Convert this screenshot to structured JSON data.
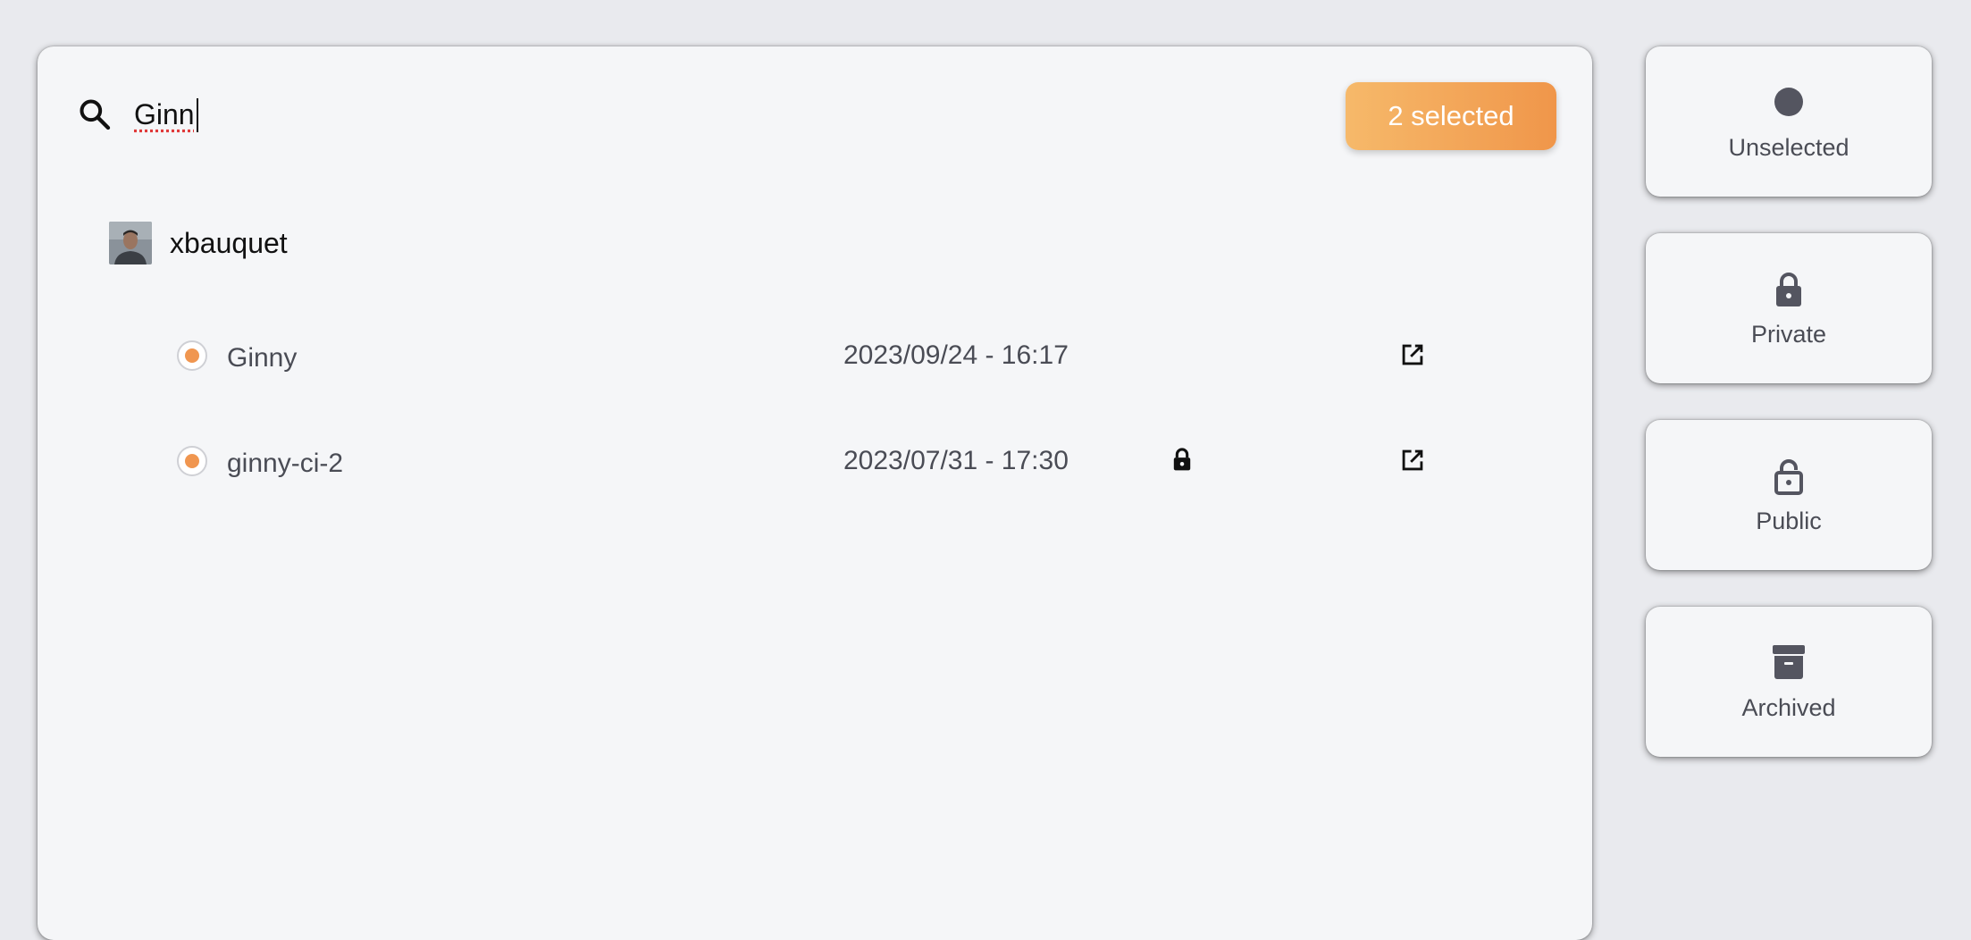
{
  "search": {
    "value": "Ginn",
    "icon": "search-icon"
  },
  "selection": {
    "label": "2 selected"
  },
  "owner": {
    "name": "xbauquet",
    "avatar": "avatar-photo"
  },
  "repositories": [
    {
      "name": "Ginny",
      "date": "2023/09/24 - 16:17",
      "private": false,
      "selected": true
    },
    {
      "name": "ginny-ci-2",
      "date": "2023/07/31 - 17:30",
      "private": true,
      "selected": true
    }
  ],
  "filters": [
    {
      "label": "Unselected",
      "icon": "dot-icon"
    },
    {
      "label": "Private",
      "icon": "lock-icon"
    },
    {
      "label": "Public",
      "icon": "unlock-icon"
    },
    {
      "label": "Archived",
      "icon": "archive-icon"
    }
  ],
  "colors": {
    "accent_start": "#f6b96a",
    "accent_end": "#f0964a",
    "panel_bg": "#f5f6f8",
    "page_bg": "#e9eaee",
    "icon": "#545560"
  }
}
